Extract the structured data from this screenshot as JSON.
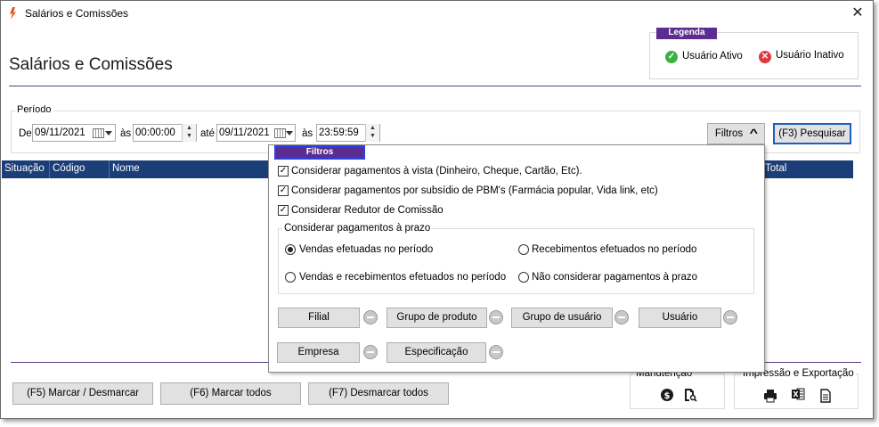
{
  "window": {
    "title": "Salários e Comissões",
    "close_glyph": "✕"
  },
  "page": {
    "title": "Salários e Comissões"
  },
  "legend": {
    "title": "Legenda",
    "active_label": "Usuário Ativo",
    "inactive_label": "Usuário Inativo",
    "active_glyph": "✓",
    "inactive_glyph": "✕",
    "active_color": "#3cb043",
    "inactive_color": "#e0383e"
  },
  "periodo": {
    "label": "Período",
    "de_label": "De",
    "date_from": "09/11/2021",
    "as_label_1": "às",
    "time_from": "00:00:00",
    "ate_label": "até",
    "date_to": "09/11/2021",
    "as_label_2": "às",
    "time_to": "23:59:59"
  },
  "toolbar": {
    "filtros_label": "Filtros",
    "pesquisar_label": "(F3) Pesquisar",
    "filtros_chevron": "^"
  },
  "grid": {
    "columns": [
      "Situação",
      "Código",
      "Nome",
      "Total"
    ]
  },
  "filtros_popup": {
    "title": "Filtros",
    "checkboxes": [
      {
        "label": "Considerar pagamentos à vista (Dinheiro, Cheque, Cartão, Etc).",
        "checked": true
      },
      {
        "label": "Considerar pagamentos por subsídio de PBM's (Farmácia popular, Vida link, etc)",
        "checked": true
      },
      {
        "label": "Considerar Redutor de Comissão",
        "checked": true
      }
    ],
    "prazo_group_label": "Considerar pagamentos à prazo",
    "radios": [
      {
        "label": "Vendas efetuadas no período",
        "selected": true
      },
      {
        "label": "Recebimentos efetuados no período",
        "selected": false
      },
      {
        "label": "Vendas e recebimentos efetuados no período",
        "selected": false
      },
      {
        "label": "Não considerar pagamentos à prazo",
        "selected": false
      }
    ],
    "filter_buttons": [
      "Filial",
      "Grupo de produto",
      "Grupo de usuário",
      "Usuário",
      "Empresa",
      "Especificação"
    ]
  },
  "footer": {
    "marcar_desmarcar": "(F5) Marcar / Desmarcar",
    "marcar_todos": "(F6) Marcar todos",
    "desmarcar_todos": "(F7) Desmarcar todos",
    "manutencao_label": "Manutenção",
    "impressao_label": "Impressão e Exportação",
    "manutencao_icons": [
      "dollar-icon",
      "document-search-icon"
    ],
    "impressao_icons": [
      "printer-icon",
      "excel-icon",
      "document-icon"
    ]
  }
}
